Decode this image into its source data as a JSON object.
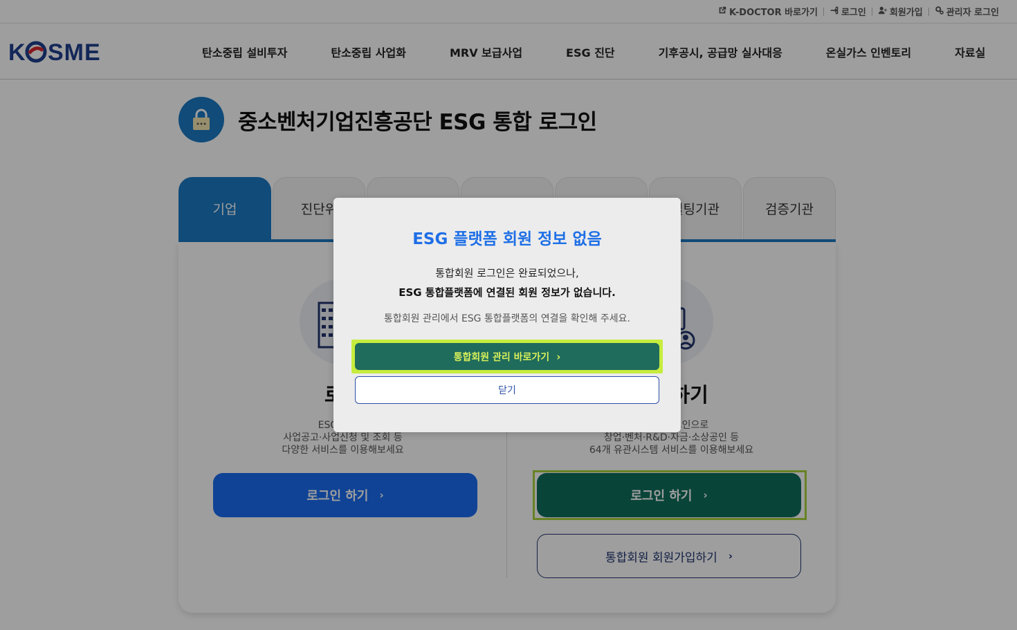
{
  "util_bar": {
    "kdoctor": "K-DOCTOR 바로가기",
    "login": "로그인",
    "signup": "회원가입",
    "admin_login": "관리자 로그인"
  },
  "logo": {
    "text": "KOSME"
  },
  "gnb": [
    "탄소중립 설비투자",
    "탄소중립 사업화",
    "MRV 보급사업",
    "ESG 진단",
    "기후공시, 공급망 실사대응",
    "온실가스 인벤토리",
    "자료실"
  ],
  "page_title": "중소벤처기업진흥공단 ESG 통합 로그인",
  "tabs": [
    "기업",
    "진단위",
    "",
    "",
    "",
    "설팅기관",
    "검증기관"
  ],
  "left_col": {
    "heading": "로그",
    "desc_lines": [
      "ESG 통합플",
      "사업공고·사업신청 및 조회 등",
      "다양한 서비스를 이용해보세요"
    ],
    "login_button": "로그인 하기"
  },
  "right_col": {
    "heading": "그인하기",
    "desc_lines": [
      "한번의 로그인으로",
      "창업·벤처·R&D·자금·소상공인 등",
      "64개 유관시스템 서비스를 이용해보세요"
    ],
    "login_button": "로그인 하기",
    "signup_button": "통합회원 회원가입하기"
  },
  "modal": {
    "title": "ESG 플랫폼 회원 정보 없음",
    "line1": "통합회원 로그인은 완료되었으나,",
    "line2": "ESG 통합플랫폼에 연결된 회원 정보가 없습니다.",
    "line3": "통합회원 관리에서 ESG 통합플랫폼의 연결을 확인해 주세요.",
    "primary_button": "통합회원 관리 바로가기",
    "close_button": "닫기"
  },
  "chevron": "›",
  "colors": {
    "brand_blue": "#1a7ac4",
    "login_blue": "#1a6cf0",
    "integrated_green": "#0f6e5d",
    "highlight": "#c6ec3e",
    "modal_title": "#1e6fe6"
  },
  "icons": [
    "external-link-icon",
    "login-icon",
    "user-plus-icon",
    "gears-icon",
    "lock-icon",
    "building-icon",
    "user-badge-icon"
  ]
}
